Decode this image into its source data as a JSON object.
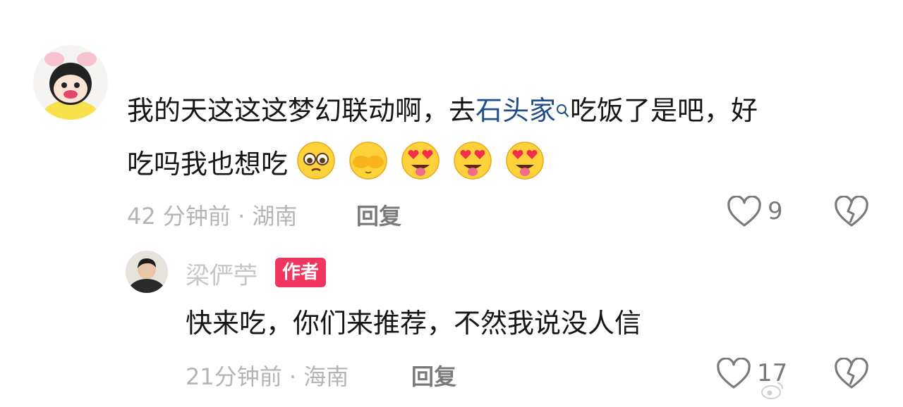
{
  "comment": {
    "text_line1_prefix": "我的天这这这梦幻联动啊，去",
    "link_text": "石头家",
    "text_line1_suffix": "吃饭了是吧，好",
    "text_line2": "吃吗我也想吃",
    "emojis": [
      "pleading-face-emoji",
      "hiding-face-emoji",
      "heart-eyes-tongue-emoji",
      "heart-eyes-tongue-emoji",
      "heart-eyes-tongue-emoji"
    ],
    "meta": "42 分钟前 · 湖南",
    "reply_label": "回复",
    "like_count": "9"
  },
  "reply": {
    "author": "梁俨苧",
    "badge": "作者",
    "text": "快来吃，你们来推荐，不然我说没人信",
    "meta": "21分钟前 · 海南",
    "reply_label": "回复",
    "like_count": "17"
  },
  "colors": {
    "link": "#1f4f86",
    "badge": "#f0365f"
  }
}
